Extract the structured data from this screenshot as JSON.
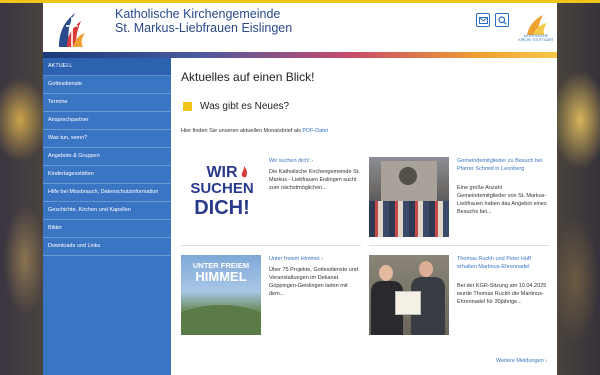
{
  "header": {
    "title_line1": "Katholische Kirchengemeinde",
    "title_line2": "St. Markus-Liebfrauen Eislingen",
    "partner_logo_text": "KATHOLISCHE KIRCHE STUTTGART"
  },
  "sidebar": {
    "items": [
      {
        "label": "AKTUELL"
      },
      {
        "label": "Gottesdienste"
      },
      {
        "label": "Termine"
      },
      {
        "label": "Ansprechpartner"
      },
      {
        "label": "Was tun, wenn?"
      },
      {
        "label": "Angebote & Gruppen"
      },
      {
        "label": "Kindertagesstätten"
      },
      {
        "label": "Hilfe bei Missbrauch, Datenschutzinformation"
      },
      {
        "label": "Geschichte, Kirchen und Kapellen"
      },
      {
        "label": "Bilder"
      },
      {
        "label": "Downloads und Links"
      }
    ]
  },
  "main": {
    "page_title": "Aktuelles auf einen Blick!",
    "news_heading": "Was gibt es Neues?",
    "intro_text": "Hier finden Sie unseren aktuellen Monatsbrief als",
    "intro_link": "PDF-Datei",
    "more_link": "Weitere Meldungen",
    "cards": [
      {
        "title": "Wir suchen dich!",
        "text": "Die Katholische Kirchengemeinde St. Markus - Liebfrauen Eislingen sucht zum nächstmöglichen...",
        "thumb_text_1": "WIR",
        "thumb_text_2": "SUCHEN",
        "thumb_text_3": "DICH!"
      },
      {
        "title": "Gemeindemitglieder zu Besuch bei Pfarrer Schmid in Leonberg",
        "text": "Eine große Anzahl Gemeindemitglieder von St. Markus-Liebfrauen haben das Angebot eines Besuchs bei..."
      },
      {
        "title": "Unter freiem Himmel",
        "text": "Über 75 Projekte, Gottesdienste und Veranstaltungen im Dekanat Göppingen-Geislingen laden mit dem...",
        "thumb_text_1": "UNTER FREIEM",
        "thumb_text_2": "HIMMEL"
      },
      {
        "title": "Thomas Ruckh und Peter Huff erhalten Martinus-Ehrennadel",
        "text": "Bei der KGR-Sitzung am 10.04.2025 wurde Thomas Ruckh die Martinus-Ehrennadel für 30jährige..."
      }
    ]
  },
  "colors": {
    "accent_yellow": "#f0c419",
    "nav_blue": "#3a75c4",
    "title_blue": "#2a4a8a"
  }
}
